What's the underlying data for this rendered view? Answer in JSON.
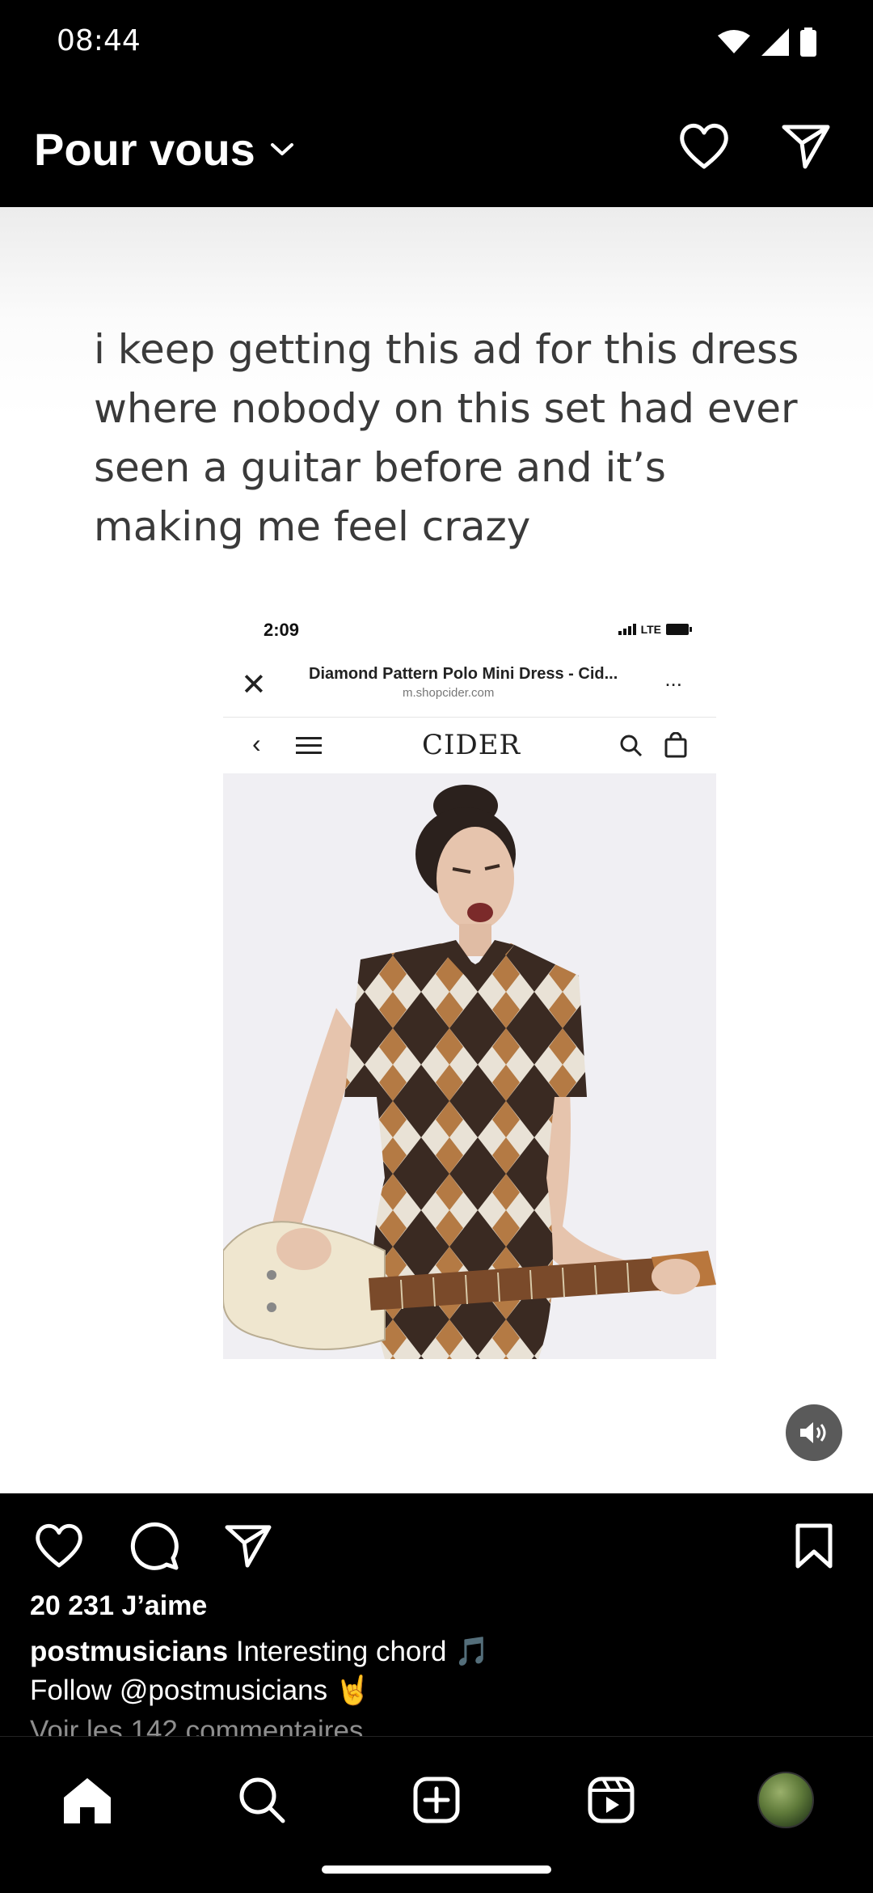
{
  "status_bar": {
    "time": "08:44"
  },
  "header": {
    "title": "Pour vous"
  },
  "post": {
    "meme_caption": "i keep getting this ad for this dress where nobody on this set had ever seen a guitar before and it’s making me feel crazy",
    "screenshot": {
      "time": "2:09",
      "network": "LTE",
      "page_title": "Diamond Pattern Polo Mini Dress - Cid...",
      "domain": "m.shopcider.com",
      "more": "...",
      "logo": "CIDER"
    },
    "likes": "20 231 J’aime",
    "username": "postmusicians",
    "caption_text": "Interesting chord 🎵",
    "caption_line2": "Follow @postmusicians 🤘",
    "comments_link": "Voir les 142 commentaires"
  },
  "icons": {
    "wifi": "wifi-icon",
    "signal": "signal-icon",
    "battery": "battery-icon",
    "chevron": "chevron-down-icon",
    "heart": "heart-icon",
    "send": "send-icon",
    "comment": "comment-icon",
    "bookmark": "bookmark-icon",
    "volume": "volume-icon",
    "home": "home-icon",
    "search": "search-icon",
    "create": "create-icon",
    "reels": "reels-icon"
  },
  "colors": {
    "background": "#000000",
    "text": "#ffffff",
    "muted": "#8e8e8e",
    "meme_text": "#3a3a3a"
  }
}
